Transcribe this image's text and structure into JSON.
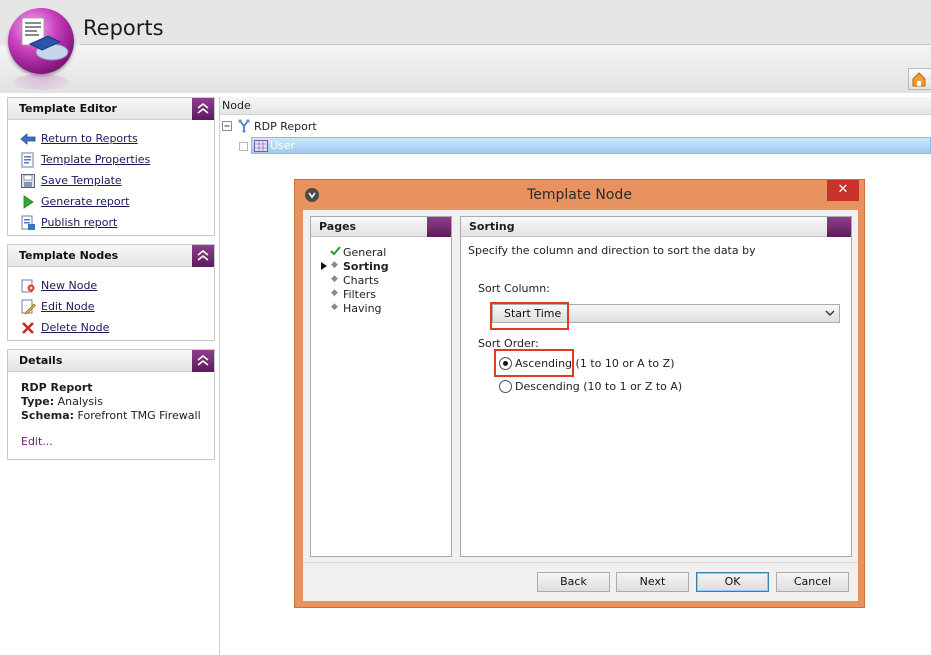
{
  "app": {
    "title": "Reports"
  },
  "template_editor": {
    "title": "Template Editor",
    "links": [
      {
        "label": "Return to Reports",
        "icon": "arrow-left-icon"
      },
      {
        "label": "Template Properties",
        "icon": "properties-icon"
      },
      {
        "label": "Save Template",
        "icon": "save-icon"
      },
      {
        "label": "Generate report",
        "icon": "play-icon"
      },
      {
        "label": "Publish report",
        "icon": "publish-icon"
      }
    ]
  },
  "template_nodes": {
    "title": "Template Nodes",
    "links": [
      {
        "label": "New Node",
        "icon": "new-node-icon"
      },
      {
        "label": "Edit Node",
        "icon": "edit-icon"
      },
      {
        "label": "Delete Node",
        "icon": "delete-x-icon"
      }
    ]
  },
  "details": {
    "title": "Details",
    "name": "RDP Report",
    "type_label": "Type:",
    "type_value": "Analysis",
    "schema_label": "Schema:",
    "schema_value": "Forefront TMG Firewall",
    "edit": "Edit..."
  },
  "tree": {
    "header": "Node",
    "root": "RDP Report",
    "child": "User"
  },
  "dialog": {
    "title": "Template Node",
    "close_glyph": "✕",
    "pages": {
      "title": "Pages",
      "items": [
        {
          "label": "General",
          "state": "done"
        },
        {
          "label": "Sorting",
          "state": "current"
        },
        {
          "label": "Charts",
          "state": "pending"
        },
        {
          "label": "Filters",
          "state": "pending"
        },
        {
          "label": "Having",
          "state": "pending"
        }
      ]
    },
    "sorting": {
      "title": "Sorting",
      "description": "Specify the column and direction to sort the data by",
      "column_label": "Sort Column:",
      "column_value": "Start Time",
      "order_label": "Sort Order:",
      "ascending": "Ascending (1 to 10 or A to Z)",
      "descending": "Descending (10 to 1 or Z to A)",
      "selected": "ascending"
    },
    "buttons": {
      "back": "Back",
      "next": "Next",
      "ok": "OK",
      "cancel": "Cancel"
    }
  },
  "colors": {
    "accent_purple": "#5d1a5c",
    "dialog_frame": "#e8925f",
    "close_red": "#c7332b",
    "highlight_red": "#e23a1e",
    "selection_blue": "#9fcaf1"
  }
}
